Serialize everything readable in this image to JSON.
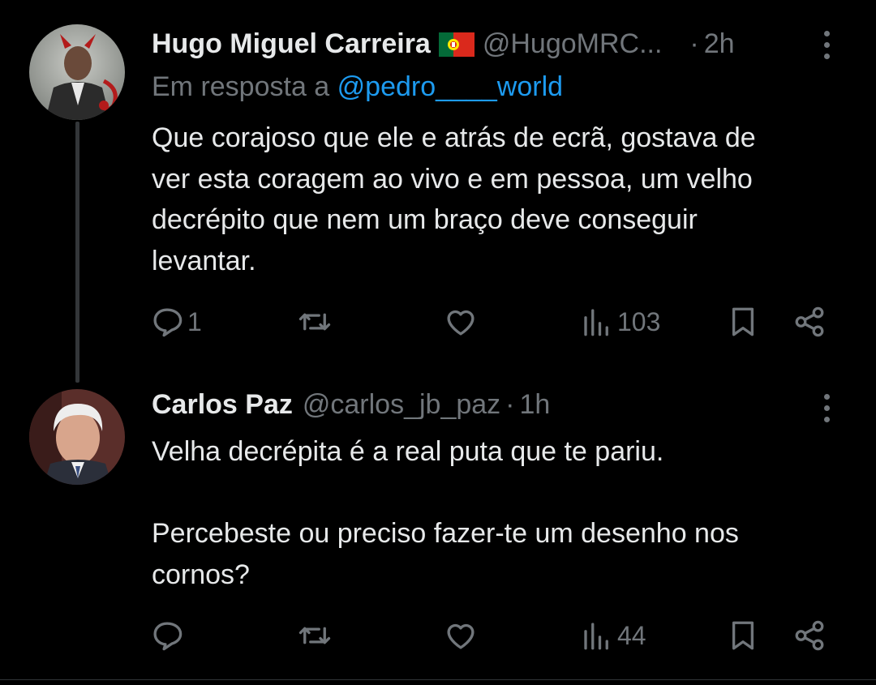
{
  "tweet1": {
    "name": "Hugo Miguel Carreira",
    "handle": "@HugoMRC...",
    "dot": "·",
    "time": "2h",
    "reply_prefix": "Em resposta a",
    "reply_handle": "@pedro____world",
    "text_lines": [
      "Que corajoso que ele e atrás de  ecrã, gostava de",
      "ver esta coragem ao vivo e em pessoa, um velho",
      "decrépito que nem um braço deve conseguir",
      "levantar."
    ],
    "stats": {
      "replies": "1",
      "views": "103"
    }
  },
  "tweet2": {
    "name": "Carlos Paz",
    "handle": "@carlos_jb_paz",
    "dot": "·",
    "time": "1h",
    "paragraph1": "Velha decrépita é a real puta que te pariu.",
    "paragraph2_lines": [
      "Percebeste ou preciso fazer-te um desenho nos",
      "cornos?"
    ],
    "stats": {
      "views": "44"
    }
  },
  "icons": {
    "reply": "reply-icon",
    "retweet": "retweet-icon",
    "like": "heart-icon",
    "views": "views-icon",
    "bookmark": "bookmark-icon",
    "share": "share-icon",
    "more": "more-vertical-icon",
    "flag": "portugal-flag-icon"
  },
  "colors": {
    "background": "#000000",
    "text": "#e7e9ea",
    "secondary": "#71767b",
    "link": "#1d9bf0",
    "thread_line": "#333639"
  }
}
